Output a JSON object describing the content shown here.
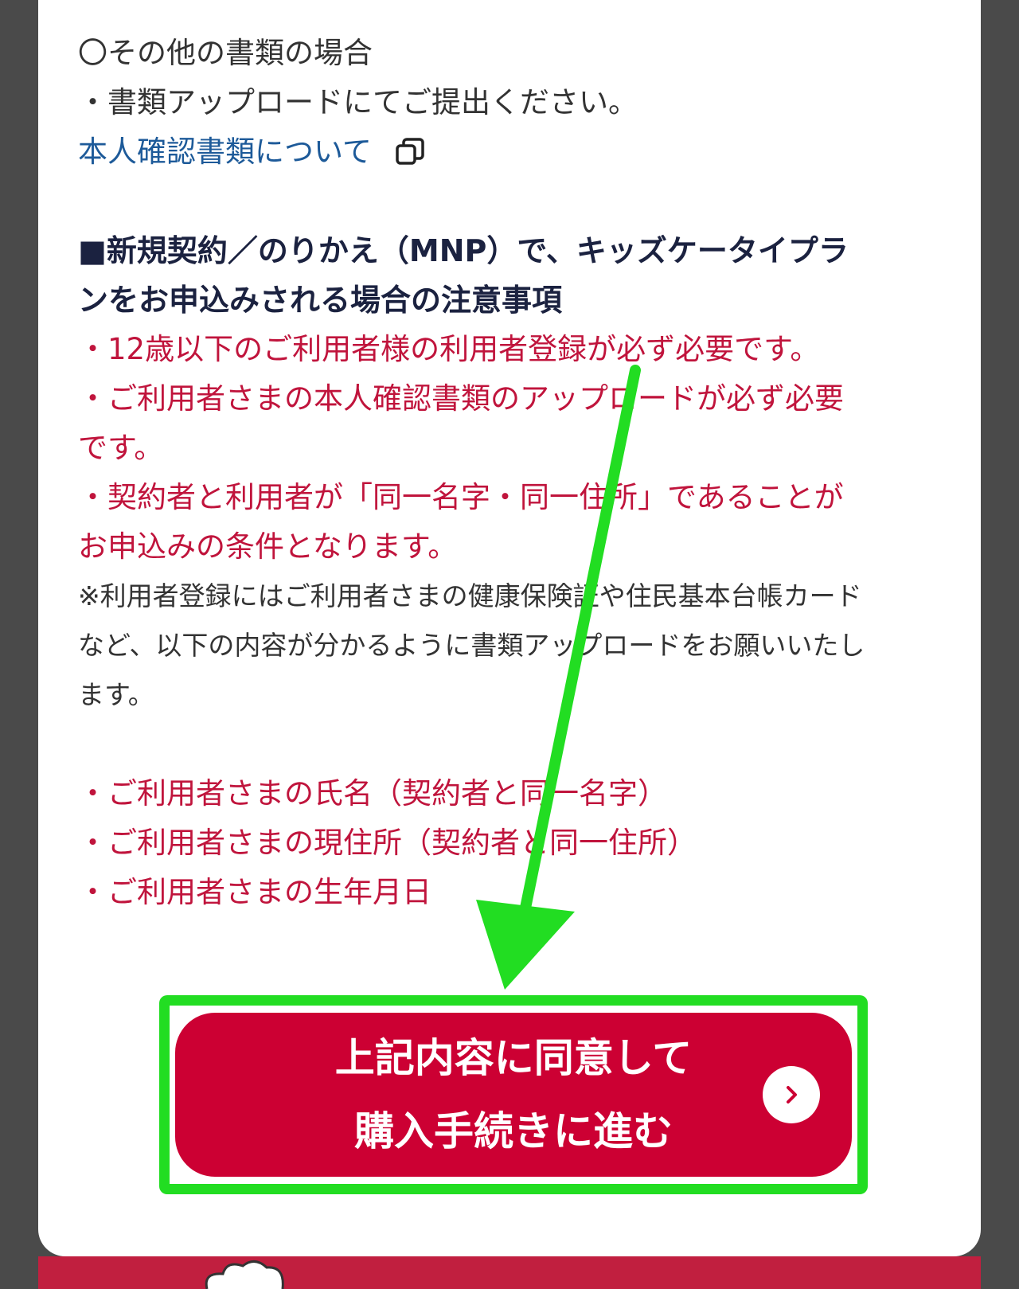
{
  "other_docs": {
    "heading": "〇その他の書類の場合",
    "instruction": "・書類アップロードにてご提出ください。",
    "id_docs_link": "本人確認書類について"
  },
  "kids_notice": {
    "heading_line1": "■新規契約／のりかえ（MNP）で、キッズケータイプラ",
    "heading_line2": "ンをお申込みされる場合の注意事項",
    "red_lines": [
      "・12歳以下のご利用者様の利用者登録が必ず必要です。",
      "・ご利用者さまの本人確認書類のアップロードが必ず必要",
      "です。",
      "・契約者と利用者が「同一名字・同一住所」であることが",
      "お申込みの条件となります。"
    ],
    "note_lines": [
      "※利用者登録にはご利用者さまの健康保険証や住民基本台帳カード",
      "など、以下の内容が分かるように書類アップロードをお願いいたし",
      "ます。"
    ],
    "required_items": [
      "・ご利用者さまの氏名（契約者と同一名字）",
      "・ご利用者さまの現住所（契約者と同一住所）",
      "・ご利用者さまの生年月日"
    ]
  },
  "agree_button": {
    "line1": "上記内容に同意して",
    "line2": "購入手続きに進む"
  },
  "colors": {
    "notice_red": "#c0143c",
    "button_red": "#cc0033",
    "highlight_green": "#22dd22",
    "link_blue": "#1d5a99"
  },
  "icons": [
    "external-link-icon",
    "chevron-right-icon"
  ]
}
